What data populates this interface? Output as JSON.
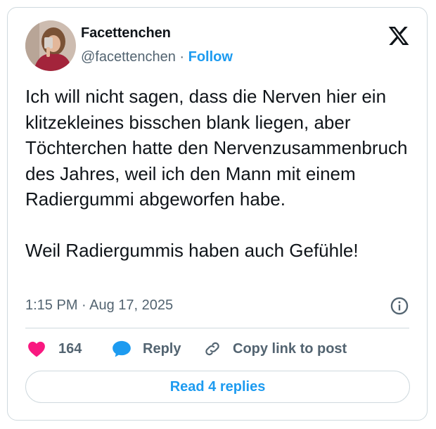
{
  "author": {
    "name": "Facettenchen",
    "handle": "@facettenchen",
    "separator": " · ",
    "follow_label": "Follow"
  },
  "tweet": {
    "lines": [
      "Ich will nicht sagen, dass die Nerven hier ein klitzekleines bisschen blank liegen, aber Töchterchen hatte den Nervenzusammenbruch des Jahres, weil ich den Mann mit einem Radiergummi abgeworfen habe.",
      "Weil Radiergummis haben auch Gefühle!"
    ],
    "timestamp": "1:15 PM · Aug 17, 2025"
  },
  "actions": {
    "like_count": "164",
    "reply_label": "Reply",
    "copy_label": "Copy link to post"
  },
  "read_replies_label": "Read 4 replies",
  "colors": {
    "accent": "#1d9bf0",
    "like": "#f91880",
    "muted": "#536471",
    "border": "#cfd9de"
  },
  "icons": {
    "brand": "x-logo-icon",
    "info": "info-icon",
    "like": "heart-icon",
    "reply": "speech-bubble-icon",
    "copy": "link-icon"
  }
}
